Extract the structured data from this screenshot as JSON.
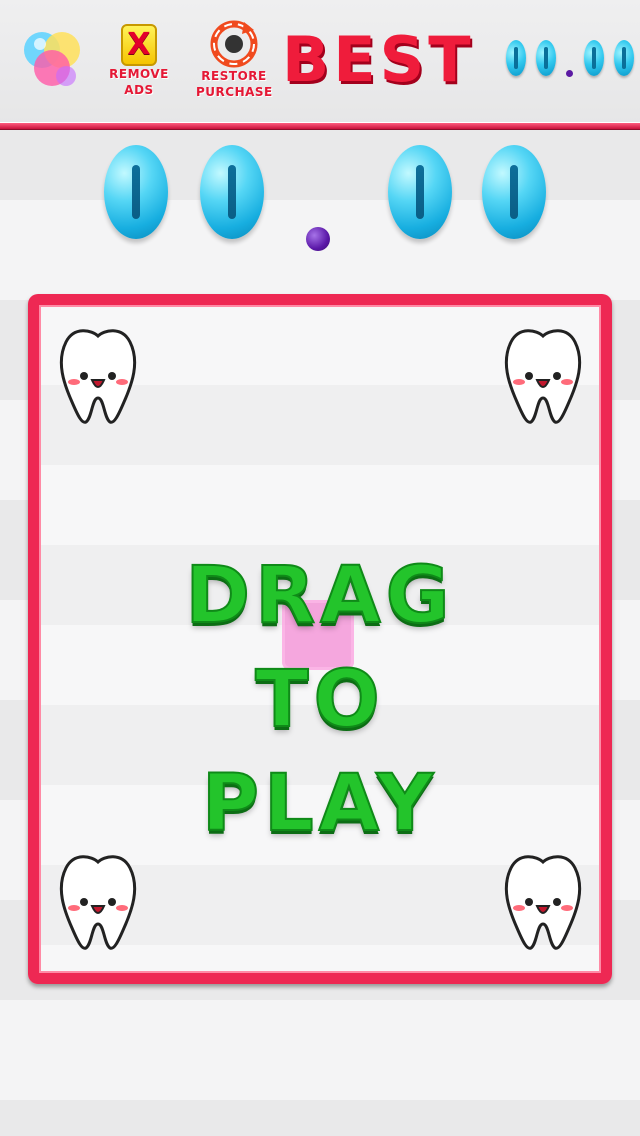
{
  "header": {
    "remove_ads_line1": "REMOVE",
    "remove_ads_line2": "ADS",
    "remove_ads_icon": "x-icon",
    "restore_purchase_line1": "RESTORE",
    "restore_purchase_line2": "PURCHASE",
    "restore_icon": "restore-icon",
    "color_balls_icon": "color-balls-icon",
    "best_title": "BEST",
    "best_score": "00.00"
  },
  "score": {
    "current": "00.00"
  },
  "game": {
    "prompt_line1": "DRAG TO",
    "prompt_line2": "PLAY",
    "tooth_icon": "tooth-icon"
  },
  "colors": {
    "accent_red": "#ee2853",
    "score_cyan": "#33c9ef",
    "prompt_green": "#23c42b",
    "player_pink": "#f48cd6",
    "decimal_purple": "#5b18a8"
  }
}
